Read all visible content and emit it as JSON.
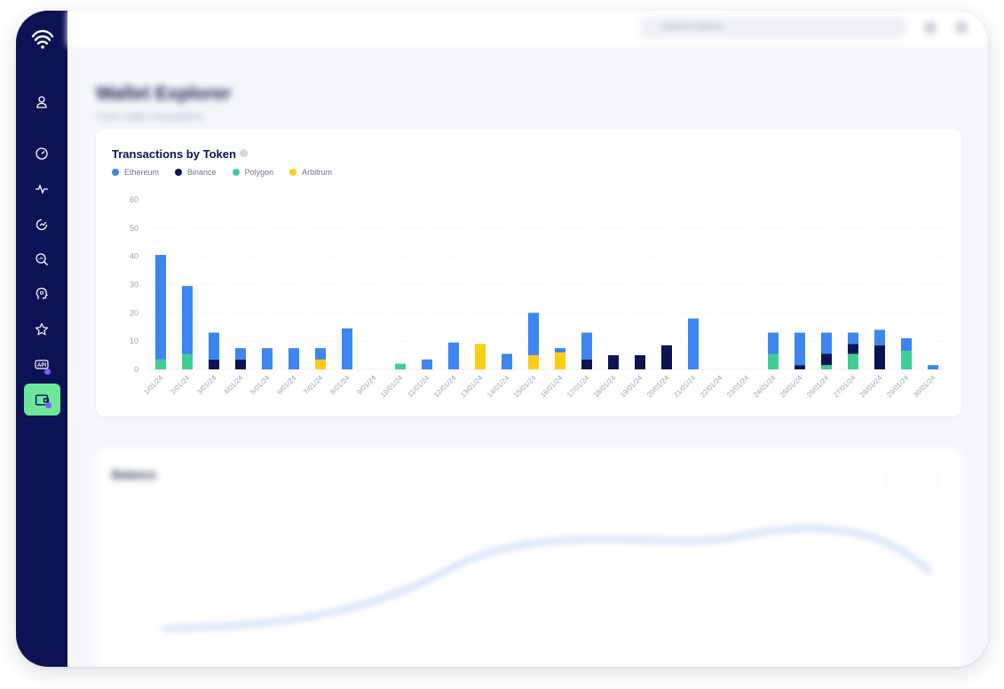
{
  "topbar": {
    "search_placeholder": "Search tokens"
  },
  "page": {
    "title": "Wallet Explorer",
    "subtitle": "Track wallet transactions"
  },
  "card": {
    "title": "Transactions by Token"
  },
  "lower_card": {
    "title": "Balance",
    "select_value": "30d"
  },
  "sidebar": {
    "icons": [
      "user-icon",
      "gauge-icon",
      "pulse-icon",
      "analytics-icon",
      "search-analytics-icon",
      "brain-icon",
      "star-icon",
      "api-icon",
      "wallet-icon"
    ]
  },
  "colors": {
    "sidebar": "#0b1354",
    "active": "#6ee79a",
    "ethereum": "#3d85f0",
    "binance": "#0b1354",
    "polygon": "#3ecf95",
    "arbitrum": "#ffcc12"
  },
  "chart_data": {
    "type": "bar",
    "stacked": true,
    "title": "Transactions by Token",
    "ylim": [
      0,
      60
    ],
    "yticks": [
      0,
      10,
      20,
      30,
      40,
      50,
      60
    ],
    "grid": true,
    "legend_position": "top-left",
    "categories": [
      "1/01/24",
      "2/01/24",
      "3/01/24",
      "4/01/24",
      "5/01/24",
      "6/01/24",
      "7/01/24",
      "8/01/24",
      "9/01/24",
      "10/01/24",
      "11/01/24",
      "12/01/24",
      "13/01/24",
      "14/01/24",
      "15/01/24",
      "16/01/24",
      "17/01/24",
      "18/01/24",
      "19/01/24",
      "20/01/24",
      "21/01/24",
      "22/01/24",
      "23/01/24",
      "24/01/24",
      "25/01/24",
      "26/01/24",
      "27/01/24",
      "28/01/24",
      "29/01/24",
      "30/01/24"
    ],
    "series": [
      {
        "name": "Polygon",
        "color": "#3ecf95",
        "values": [
          3.5,
          5.5,
          0,
          0,
          0,
          0,
          0,
          0,
          0,
          2,
          0,
          0,
          0,
          0,
          0,
          0,
          0,
          0,
          0,
          0,
          0,
          0,
          0,
          5.5,
          0,
          1.5,
          5.5,
          0,
          6.5,
          0
        ]
      },
      {
        "name": "Arbitrum",
        "color": "#ffcc12",
        "values": [
          0,
          0,
          0,
          0,
          0,
          0,
          3.5,
          0,
          0,
          0,
          0,
          0,
          9,
          0,
          5,
          6,
          0,
          0,
          0,
          0,
          0,
          0,
          0,
          0,
          0,
          0,
          0,
          0,
          0,
          0
        ]
      },
      {
        "name": "Binance",
        "color": "#0b1354",
        "values": [
          0,
          0,
          3.5,
          3.5,
          0,
          0,
          0,
          0,
          0,
          0,
          0,
          0,
          0,
          0,
          0,
          0,
          3.5,
          5,
          5,
          8.5,
          0,
          0,
          0,
          0,
          1.5,
          4,
          3.5,
          8.5,
          0,
          0
        ]
      },
      {
        "name": "Ethereum",
        "color": "#3d85f0",
        "values": [
          37,
          24,
          9.5,
          4,
          7.5,
          7.5,
          4,
          14.5,
          0,
          0,
          3.5,
          9.5,
          0,
          5.5,
          15,
          1.5,
          9.5,
          0,
          0,
          0,
          18,
          0,
          0,
          7.5,
          11.5,
          7.5,
          4,
          5.5,
          4.5,
          1.5
        ]
      }
    ]
  }
}
